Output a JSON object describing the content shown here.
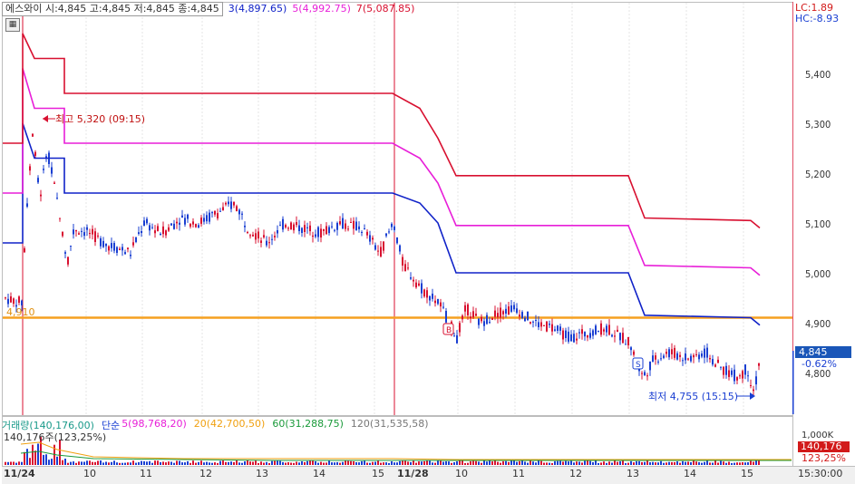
{
  "info_bar": {
    "summary": "에스와이 시:4,845 고:4,845 저:4,845 종:4,845",
    "ma3": "3(4,897.65)",
    "ma5": "5(4,992.75)",
    "ma7": "7(5,087.85)",
    "colors": {
      "ma3": "#1022c8",
      "ma5": "#e81ed8",
      "ma7": "#d81030"
    }
  },
  "toolbar": {
    "grid_icon": "grid-icon"
  },
  "price_axis": {
    "ticks": [
      "5,400",
      "5,300",
      "5,200",
      "5,100",
      "5,000",
      "4,900",
      "4,800"
    ],
    "lc": "LC:1.89",
    "hc": "HC:-8.93",
    "current_price": "4,845",
    "change_pct": "-0.62%"
  },
  "annotations": {
    "high": "최고 5,320 (09:15)",
    "low": "최저 4,755 (15:15)",
    "level": "4,910",
    "marker_b": "B",
    "marker_s": "S"
  },
  "volume": {
    "legend": [
      {
        "text": "거래량(140,176,00)",
        "color": "#1a9a8a"
      },
      {
        "text": "단순",
        "color": "#1a3fd2"
      },
      {
        "text": "5(98,768,20)",
        "color": "#e81ed8"
      },
      {
        "text": "20(42,700,50)",
        "color": "#f0a010"
      },
      {
        "text": "60(31,288,75)",
        "color": "#1a9a3a"
      },
      {
        "text": "120(31,535,58)",
        "color": "#777777"
      }
    ],
    "sub": "140,176주(123,25%)",
    "axis_1000": "1,000K",
    "badge": "140,176",
    "pct": "123,25%"
  },
  "time_axis": {
    "labels": [
      "11/24",
      "10",
      "11",
      "12",
      "13",
      "14",
      "15",
      "11/28",
      "10",
      "11",
      "12",
      "13",
      "14",
      "15"
    ],
    "end_time": "15:30:00"
  },
  "chart_data": {
    "type": "line",
    "title": "",
    "xlabel": "",
    "ylabel": "",
    "ylim": [
      4720,
      5480
    ],
    "series": [
      {
        "name": "3",
        "color": "#1022c8",
        "points": [
          [
            0,
            5060
          ],
          [
            22,
            5060
          ],
          [
            22,
            5300
          ],
          [
            35,
            5230
          ],
          [
            68,
            5230
          ],
          [
            68,
            5160
          ],
          [
            430,
            5160
          ],
          [
            460,
            5140
          ],
          [
            480,
            5100
          ],
          [
            500,
            5000
          ],
          [
            690,
            5000
          ],
          [
            708,
            4915
          ],
          [
            825,
            4910
          ],
          [
            835,
            4895
          ]
        ]
      },
      {
        "name": "5",
        "color": "#e81ed8",
        "points": [
          [
            0,
            5160
          ],
          [
            22,
            5160
          ],
          [
            22,
            5410
          ],
          [
            35,
            5330
          ],
          [
            68,
            5330
          ],
          [
            68,
            5260
          ],
          [
            430,
            5260
          ],
          [
            460,
            5230
          ],
          [
            480,
            5180
          ],
          [
            500,
            5095
          ],
          [
            690,
            5095
          ],
          [
            708,
            5015
          ],
          [
            825,
            5010
          ],
          [
            835,
            4995
          ]
        ]
      },
      {
        "name": "7",
        "color": "#d81030",
        "points": [
          [
            0,
            5260
          ],
          [
            22,
            5260
          ],
          [
            22,
            5480
          ],
          [
            35,
            5430
          ],
          [
            68,
            5430
          ],
          [
            68,
            5360
          ],
          [
            430,
            5360
          ],
          [
            460,
            5330
          ],
          [
            480,
            5270
          ],
          [
            500,
            5195
          ],
          [
            690,
            5195
          ],
          [
            708,
            5110
          ],
          [
            825,
            5105
          ],
          [
            835,
            5090
          ]
        ]
      }
    ],
    "level_line": 4910,
    "current": 4845
  }
}
